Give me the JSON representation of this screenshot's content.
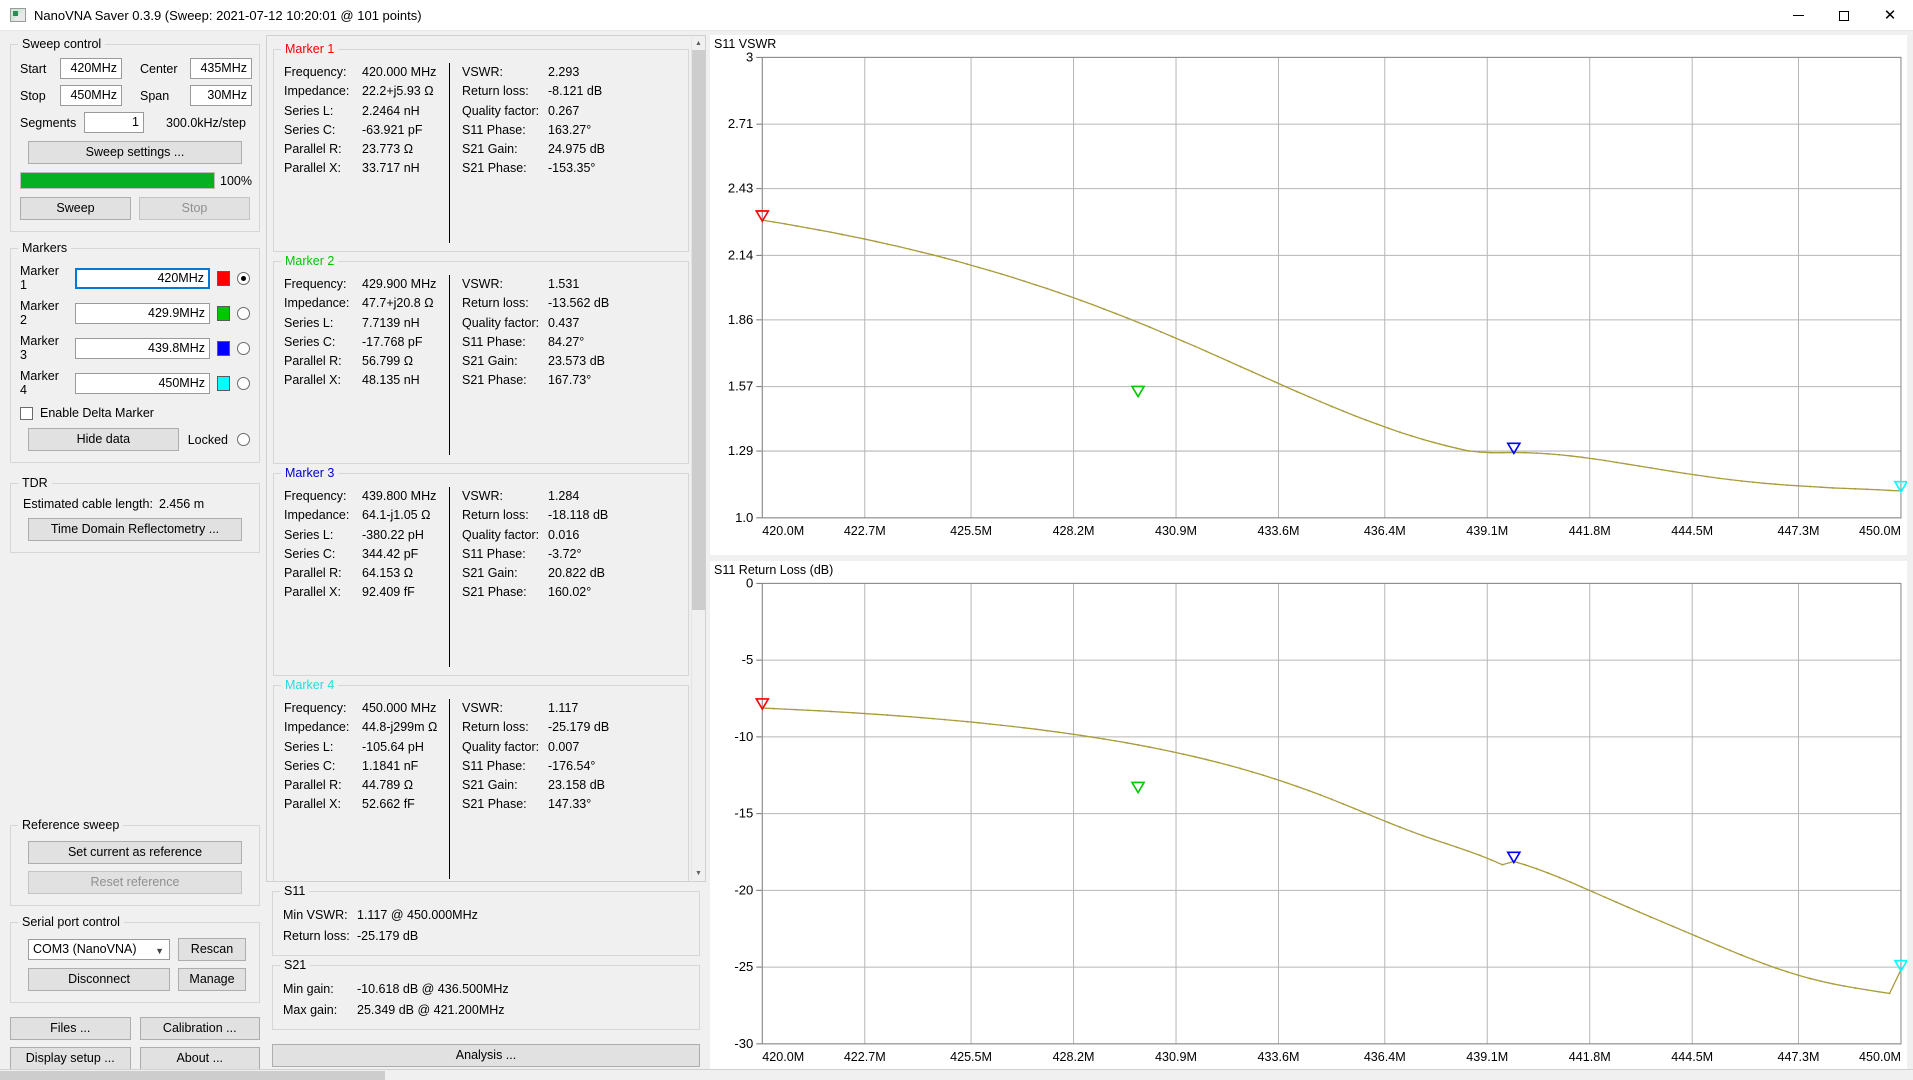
{
  "window": {
    "title": "NanoVNA Saver 0.3.9 (Sweep: 2021-07-12 10:20:01 @ 101 points)",
    "minimize": "–",
    "maximize": "☐",
    "close": "✕"
  },
  "sweep_control": {
    "legend": "Sweep control",
    "start_label": "Start",
    "start_value": "420MHz",
    "stop_label": "Stop",
    "stop_value": "450MHz",
    "center_label": "Center",
    "center_value": "435MHz",
    "span_label": "Span",
    "span_value": "30MHz",
    "segments_label": "Segments",
    "segments_value": "1",
    "step_text": "300.0kHz/step",
    "settings_button": "Sweep settings ...",
    "progress_percent": "100%",
    "progress_value": 100,
    "sweep_button": "Sweep",
    "stop_button": "Stop"
  },
  "markers_panel": {
    "legend": "Markers",
    "rows": [
      {
        "label": "Marker 1",
        "value": "420MHz",
        "color": "#ff0000",
        "selected": true
      },
      {
        "label": "Marker 2",
        "value": "429.9MHz",
        "color": "#00c800",
        "selected": false
      },
      {
        "label": "Marker 3",
        "value": "439.8MHz",
        "color": "#0000ff",
        "selected": false
      },
      {
        "label": "Marker 4",
        "value": "450MHz",
        "color": "#00ffff",
        "selected": false
      }
    ],
    "delta_label": "Enable Delta Marker",
    "hide_data_button": "Hide data",
    "locked_label": "Locked"
  },
  "tdr": {
    "legend": "TDR",
    "cable_label": "Estimated cable length:",
    "cable_value": "2.456 m",
    "button": "Time Domain Reflectometry ..."
  },
  "reference_sweep": {
    "legend": "Reference sweep",
    "set_button": "Set current as reference",
    "reset_button": "Reset reference"
  },
  "serial_port": {
    "legend": "Serial port control",
    "port_value": "COM3 (NanoVNA)",
    "rescan_button": "Rescan",
    "disconnect_button": "Disconnect",
    "manage_button": "Manage"
  },
  "bottom_buttons": {
    "files": "Files ...",
    "calibration": "Calibration ...",
    "display_setup": "Display setup ...",
    "about": "About ...",
    "analysis": "Analysis ..."
  },
  "markers": [
    {
      "title": "Marker 1",
      "color": "#ff0000",
      "left": [
        {
          "k": "Frequency:",
          "v": "420.000 MHz"
        },
        {
          "k": "Impedance:",
          "v": "22.2+j5.93 Ω"
        },
        {
          "k": "Series L:",
          "v": "2.2464 nH"
        },
        {
          "k": "Series C:",
          "v": "-63.921 pF"
        },
        {
          "k": "Parallel R:",
          "v": "23.773 Ω"
        },
        {
          "k": "Parallel X:",
          "v": "33.717 nH"
        }
      ],
      "right": [
        {
          "k": "VSWR:",
          "v": "2.293"
        },
        {
          "k": "Return loss:",
          "v": "-8.121 dB"
        },
        {
          "k": "Quality factor:",
          "v": "0.267"
        },
        {
          "k": "S11 Phase:",
          "v": "163.27°"
        },
        {
          "k": "S21 Gain:",
          "v": "24.975 dB"
        },
        {
          "k": "S21 Phase:",
          "v": "-153.35°"
        }
      ]
    },
    {
      "title": "Marker 2",
      "color": "#00c800",
      "left": [
        {
          "k": "Frequency:",
          "v": "429.900 MHz"
        },
        {
          "k": "Impedance:",
          "v": "47.7+j20.8 Ω"
        },
        {
          "k": "Series L:",
          "v": "7.7139 nH"
        },
        {
          "k": "Series C:",
          "v": "-17.768 pF"
        },
        {
          "k": "Parallel R:",
          "v": "56.799 Ω"
        },
        {
          "k": "Parallel X:",
          "v": "48.135 nH"
        }
      ],
      "right": [
        {
          "k": "VSWR:",
          "v": "1.531"
        },
        {
          "k": "Return loss:",
          "v": "-13.562 dB"
        },
        {
          "k": "Quality factor:",
          "v": "0.437"
        },
        {
          "k": "S11 Phase:",
          "v": "84.27°"
        },
        {
          "k": "S21 Gain:",
          "v": "23.573 dB"
        },
        {
          "k": "S21 Phase:",
          "v": "167.73°"
        }
      ]
    },
    {
      "title": "Marker 3",
      "color": "#0000cd",
      "left": [
        {
          "k": "Frequency:",
          "v": "439.800 MHz"
        },
        {
          "k": "Impedance:",
          "v": "64.1-j1.05 Ω"
        },
        {
          "k": "Series L:",
          "v": "-380.22 pH"
        },
        {
          "k": "Series C:",
          "v": "344.42 pF"
        },
        {
          "k": "Parallel R:",
          "v": "64.153 Ω"
        },
        {
          "k": "Parallel X:",
          "v": "92.409 fF"
        }
      ],
      "right": [
        {
          "k": "VSWR:",
          "v": "1.284"
        },
        {
          "k": "Return loss:",
          "v": "-18.118 dB"
        },
        {
          "k": "Quality factor:",
          "v": "0.016"
        },
        {
          "k": "S11 Phase:",
          "v": "-3.72°"
        },
        {
          "k": "S21 Gain:",
          "v": "20.822 dB"
        },
        {
          "k": "S21 Phase:",
          "v": "160.02°"
        }
      ]
    },
    {
      "title": "Marker 4",
      "color": "#22dddd",
      "left": [
        {
          "k": "Frequency:",
          "v": "450.000 MHz"
        },
        {
          "k": "Impedance:",
          "v": "44.8-j299m Ω"
        },
        {
          "k": "Series L:",
          "v": "-105.64 pH"
        },
        {
          "k": "Series C:",
          "v": "1.1841 nF"
        },
        {
          "k": "Parallel R:",
          "v": "44.789 Ω"
        },
        {
          "k": "Parallel X:",
          "v": "52.662 fF"
        }
      ],
      "right": [
        {
          "k": "VSWR:",
          "v": "1.117"
        },
        {
          "k": "Return loss:",
          "v": "-25.179 dB"
        },
        {
          "k": "Quality factor:",
          "v": "0.007"
        },
        {
          "k": "S11 Phase:",
          "v": "-176.54°"
        },
        {
          "k": "S21 Gain:",
          "v": "23.158 dB"
        },
        {
          "k": "S21 Phase:",
          "v": "147.33°"
        }
      ]
    }
  ],
  "s11_summary": {
    "legend": "S11",
    "min_vswr_label": "Min VSWR:",
    "min_vswr_value": "1.117 @ 450.000MHz",
    "return_loss_label": "Return loss:",
    "return_loss_value": "-25.179 dB"
  },
  "s21_summary": {
    "legend": "S21",
    "min_gain_label": "Min gain:",
    "min_gain_value": "-10.618 dB @ 436.500MHz",
    "max_gain_label": "Max gain:",
    "max_gain_value": "25.349 dB @ 421.200MHz"
  },
  "chart_data": [
    {
      "type": "line",
      "title": "S11 VSWR",
      "xlabel": "",
      "ylabel": "",
      "grid": true,
      "legend": "none",
      "line_color": "#a89c3c",
      "xlim": [
        420.0,
        450.0
      ],
      "ylim": [
        1.0,
        3.0
      ],
      "xticklabels": [
        "420.0M",
        "422.7M",
        "425.5M",
        "428.2M",
        "430.9M",
        "433.6M",
        "436.4M",
        "439.1M",
        "441.8M",
        "444.5M",
        "447.3M",
        "450.0M"
      ],
      "xticks": [
        420.0,
        422.7,
        425.5,
        428.2,
        430.9,
        433.6,
        436.4,
        439.1,
        441.8,
        444.5,
        447.3,
        450.0
      ],
      "yticklabels": [
        "3",
        "2.71",
        "2.43",
        "2.14",
        "1.86",
        "1.57",
        "1.29",
        "1.0"
      ],
      "yticks": [
        3.0,
        2.71,
        2.43,
        2.14,
        1.86,
        1.57,
        1.29,
        1.0
      ],
      "x": [
        420.0,
        420.3,
        420.6,
        420.9,
        421.2,
        421.5,
        421.8,
        422.1,
        422.4,
        422.7,
        423.0,
        423.3,
        423.6,
        423.9,
        424.2,
        424.5,
        424.8,
        425.1,
        425.4,
        425.7,
        426.0,
        426.3,
        426.6,
        426.9,
        427.2,
        427.5,
        427.8,
        428.1,
        428.4,
        428.7,
        429.0,
        429.3,
        429.6,
        429.9,
        430.2,
        430.5,
        430.8,
        431.1,
        431.4,
        431.7,
        432.0,
        432.3,
        432.6,
        432.9,
        433.2,
        433.5,
        433.8,
        434.1,
        434.4,
        434.7,
        435.0,
        435.3,
        435.6,
        435.9,
        436.2,
        436.5,
        436.8,
        437.1,
        437.4,
        437.7,
        438.0,
        438.3,
        438.6,
        438.9,
        439.2,
        439.5,
        439.8,
        440.1,
        440.4,
        440.7,
        441.0,
        441.3,
        441.6,
        441.9,
        442.2,
        442.5,
        442.8,
        443.1,
        443.4,
        443.7,
        444.0,
        444.3,
        444.6,
        444.9,
        445.2,
        445.5,
        445.8,
        446.1,
        446.4,
        446.7,
        447.0,
        447.3,
        447.6,
        447.9,
        448.2,
        448.5,
        448.8,
        449.1,
        449.4,
        449.7,
        450.0
      ],
      "y": [
        2.293,
        2.285,
        2.277,
        2.268,
        2.259,
        2.25,
        2.241,
        2.231,
        2.221,
        2.211,
        2.2,
        2.189,
        2.178,
        2.166,
        2.154,
        2.142,
        2.129,
        2.116,
        2.102,
        2.088,
        2.074,
        2.059,
        2.044,
        2.028,
        2.012,
        1.996,
        1.979,
        1.962,
        1.944,
        1.926,
        1.907,
        1.888,
        1.869,
        1.849,
        1.829,
        1.808,
        1.787,
        1.766,
        1.745,
        1.723,
        1.701,
        1.679,
        1.657,
        1.635,
        1.613,
        1.591,
        1.569,
        1.547,
        1.526,
        1.505,
        1.484,
        1.464,
        1.444,
        1.425,
        1.407,
        1.389,
        1.372,
        1.356,
        1.341,
        1.327,
        1.314,
        1.302,
        1.291,
        1.286,
        1.283,
        1.283,
        1.284,
        1.283,
        1.281,
        1.278,
        1.274,
        1.269,
        1.263,
        1.256,
        1.249,
        1.241,
        1.233,
        1.225,
        1.217,
        1.209,
        1.201,
        1.193,
        1.186,
        1.179,
        1.172,
        1.166,
        1.16,
        1.155,
        1.15,
        1.146,
        1.142,
        1.139,
        1.136,
        1.133,
        1.13,
        1.128,
        1.126,
        1.124,
        1.122,
        1.119,
        1.117
      ],
      "markers": [
        {
          "name": "Marker 1",
          "x": 420.0,
          "y": 2.293,
          "color": "#ff0000"
        },
        {
          "name": "Marker 2",
          "x": 429.9,
          "y": 1.531,
          "color": "#00c800"
        },
        {
          "name": "Marker 3",
          "x": 439.8,
          "y": 1.284,
          "color": "#0000ff"
        },
        {
          "name": "Marker 4",
          "x": 450.0,
          "y": 1.117,
          "color": "#00ffff"
        }
      ]
    },
    {
      "type": "line",
      "title": "S11 Return Loss (dB)",
      "xlabel": "",
      "ylabel": "",
      "grid": true,
      "legend": "none",
      "line_color": "#a89c3c",
      "xlim": [
        420.0,
        450.0
      ],
      "ylim": [
        -30.0,
        0.0
      ],
      "xticklabels": [
        "420.0M",
        "422.7M",
        "425.5M",
        "428.2M",
        "430.9M",
        "433.6M",
        "436.4M",
        "439.1M",
        "441.8M",
        "444.5M",
        "447.3M",
        "450.0M"
      ],
      "xticks": [
        420.0,
        422.7,
        425.5,
        428.2,
        430.9,
        433.6,
        436.4,
        439.1,
        441.8,
        444.5,
        447.3,
        450.0
      ],
      "yticklabels": [
        "0",
        "-5",
        "-10",
        "-15",
        "-20",
        "-25",
        "-30"
      ],
      "yticks": [
        0,
        -5,
        -10,
        -15,
        -20,
        -25,
        -30
      ],
      "x": [
        420.0,
        420.3,
        420.6,
        420.9,
        421.2,
        421.5,
        421.8,
        422.1,
        422.4,
        422.7,
        423.0,
        423.3,
        423.6,
        423.9,
        424.2,
        424.5,
        424.8,
        425.1,
        425.4,
        425.7,
        426.0,
        426.3,
        426.6,
        426.9,
        427.2,
        427.5,
        427.8,
        428.1,
        428.4,
        428.7,
        429.0,
        429.3,
        429.6,
        429.9,
        430.2,
        430.5,
        430.8,
        431.1,
        431.4,
        431.7,
        432.0,
        432.3,
        432.6,
        432.9,
        433.2,
        433.5,
        433.8,
        434.1,
        434.4,
        434.7,
        435.0,
        435.3,
        435.6,
        435.9,
        436.2,
        436.5,
        436.8,
        437.1,
        437.4,
        437.7,
        438.0,
        438.3,
        438.6,
        438.9,
        439.2,
        439.5,
        439.8,
        440.1,
        440.4,
        440.7,
        441.0,
        441.3,
        441.6,
        441.9,
        442.2,
        442.5,
        442.8,
        443.1,
        443.4,
        443.7,
        444.0,
        444.3,
        444.6,
        444.9,
        445.2,
        445.5,
        445.8,
        446.1,
        446.4,
        446.7,
        447.0,
        447.3,
        447.6,
        447.9,
        448.2,
        448.5,
        448.8,
        449.1,
        449.4,
        449.7,
        450.0
      ],
      "y": [
        -8.121,
        -8.155,
        -8.19,
        -8.226,
        -8.264,
        -8.303,
        -8.344,
        -8.387,
        -8.432,
        -8.479,
        -8.528,
        -8.579,
        -8.633,
        -8.689,
        -8.748,
        -8.81,
        -8.874,
        -8.941,
        -9.011,
        -9.084,
        -9.16,
        -9.24,
        -9.323,
        -9.41,
        -9.5,
        -9.595,
        -9.694,
        -9.797,
        -9.905,
        -10.018,
        -10.136,
        -10.259,
        -10.388,
        -10.523,
        -10.664,
        -10.812,
        -10.967,
        -11.129,
        -11.299,
        -11.477,
        -11.663,
        -11.858,
        -12.063,
        -12.277,
        -12.501,
        -12.736,
        -12.981,
        -13.237,
        -13.504,
        -13.781,
        -14.068,
        -14.364,
        -14.667,
        -14.974,
        -15.281,
        -15.584,
        -15.878,
        -16.161,
        -16.432,
        -16.691,
        -16.942,
        -17.19,
        -17.445,
        -17.715,
        -18.009,
        -18.329,
        -18.118,
        -18.34,
        -18.59,
        -18.866,
        -19.163,
        -19.474,
        -19.795,
        -20.12,
        -20.446,
        -20.77,
        -21.091,
        -21.409,
        -21.726,
        -22.041,
        -22.355,
        -22.669,
        -22.983,
        -23.296,
        -23.607,
        -23.915,
        -24.217,
        -24.51,
        -24.791,
        -25.058,
        -25.306,
        -25.534,
        -25.74,
        -25.924,
        -26.088,
        -26.233,
        -26.364,
        -26.485,
        -26.601,
        -26.716,
        -25.179
      ],
      "markers": [
        {
          "name": "Marker 1",
          "x": 420.0,
          "y": -8.121,
          "color": "#ff0000"
        },
        {
          "name": "Marker 2",
          "x": 429.9,
          "y": -13.562,
          "color": "#00c800"
        },
        {
          "name": "Marker 3",
          "x": 439.8,
          "y": -18.118,
          "color": "#0000ff"
        },
        {
          "name": "Marker 4",
          "x": 450.0,
          "y": -25.179,
          "color": "#00ffff"
        }
      ]
    }
  ]
}
